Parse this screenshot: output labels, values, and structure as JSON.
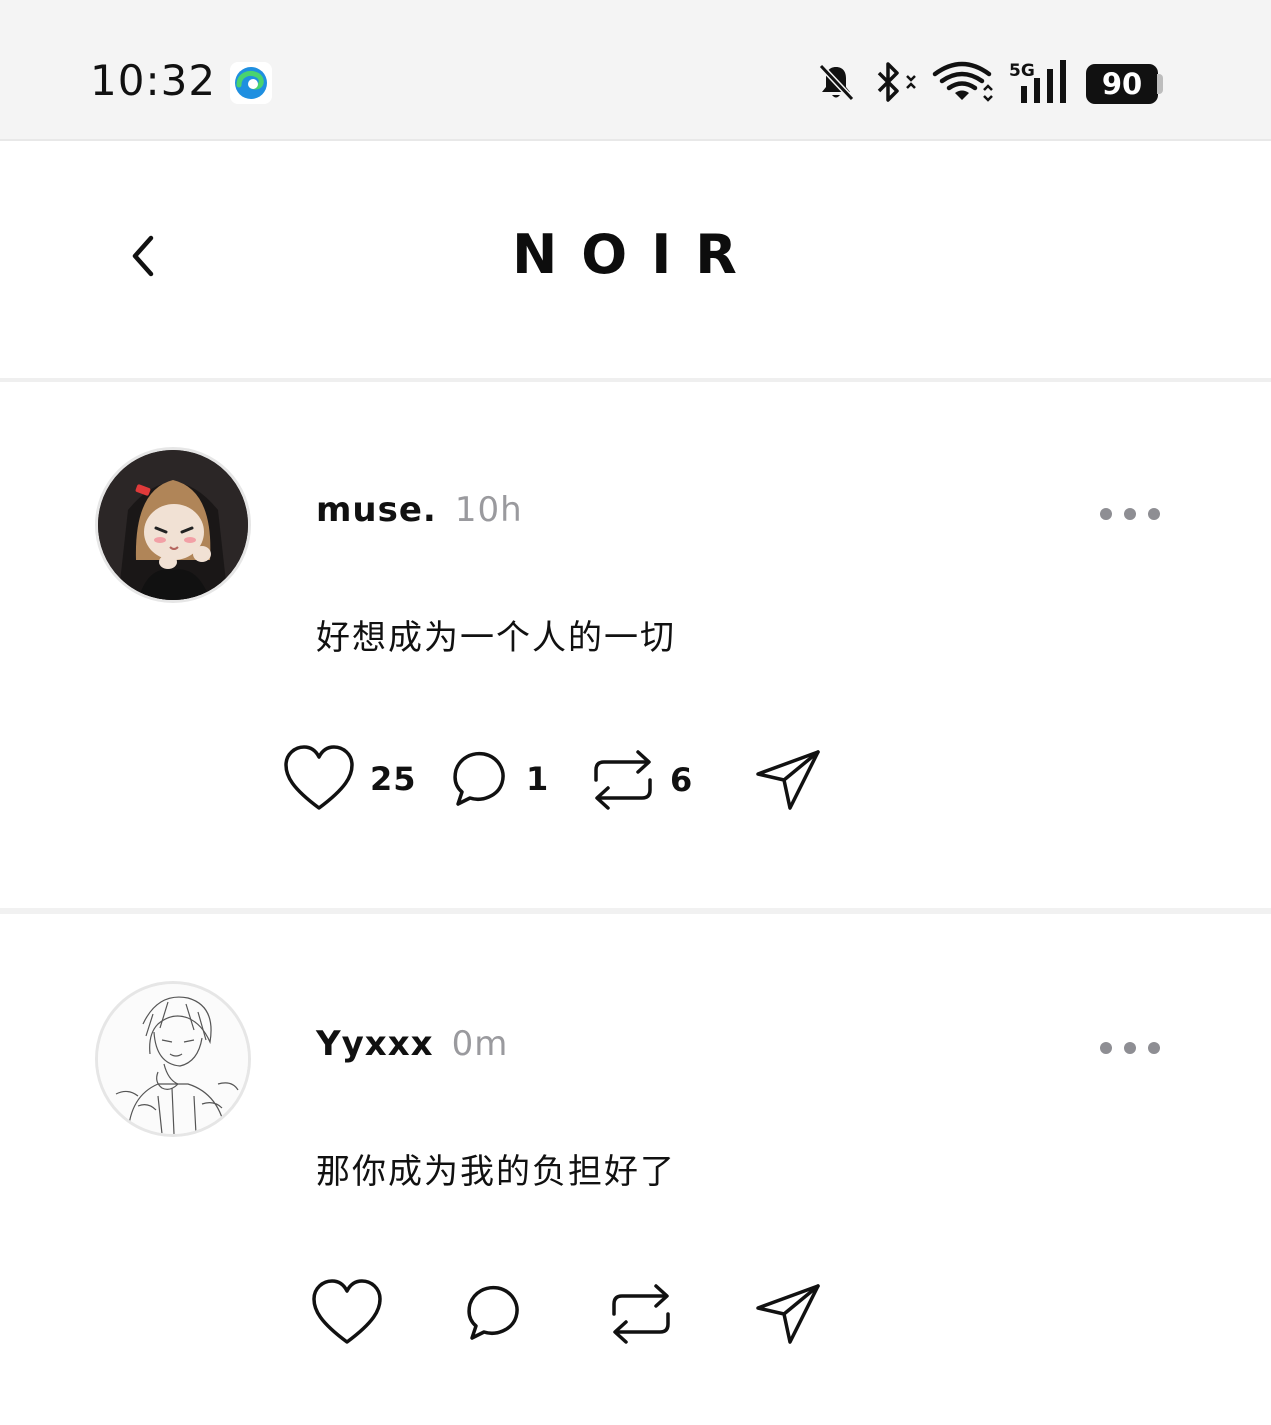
{
  "status_bar": {
    "time": "10:32",
    "battery": "90",
    "network": "5G"
  },
  "header": {
    "title": "NOIR"
  },
  "posts": [
    {
      "username": "muse.",
      "timestamp": "10h",
      "content": "好想成为一个人的一切",
      "likes": "25",
      "comments": "1",
      "reposts": "6"
    },
    {
      "username": "Yyxxx",
      "timestamp": "0m",
      "content": "那你成为我的负担好了",
      "likes": "",
      "comments": "",
      "reposts": ""
    }
  ],
  "icons": {
    "back": "chevron-left-icon",
    "more": "more-horizontal-icon",
    "like": "heart-icon",
    "comment": "comment-icon",
    "repost": "repost-icon",
    "share": "send-icon"
  },
  "colors": {
    "status_bar_bg": "#f4f4f4",
    "text": "#111111",
    "muted": "#9a9a9e",
    "divider": "#efefef"
  }
}
